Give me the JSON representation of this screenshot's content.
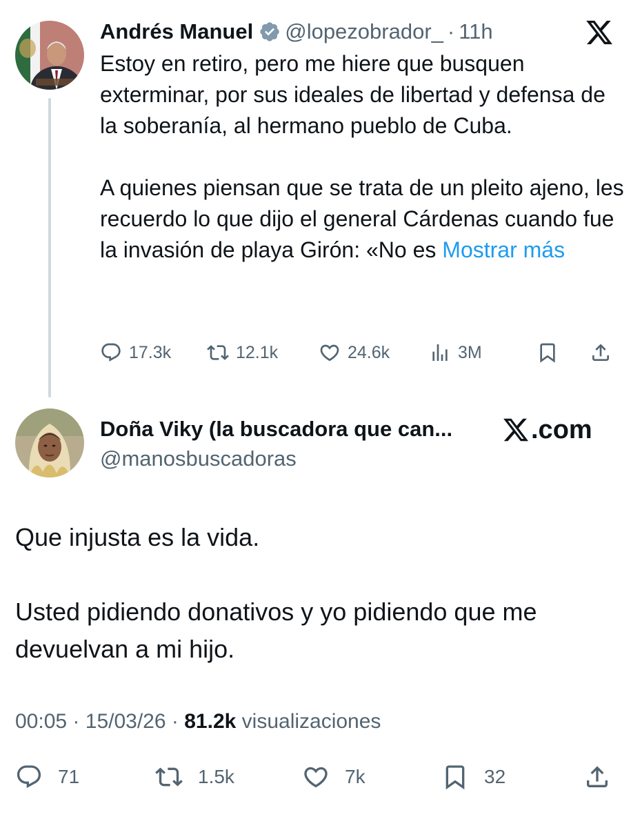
{
  "tweet_parent": {
    "display_name": "Andrés Manuel",
    "verified": true,
    "handle": "@lopezobrador_",
    "separator": "·",
    "time": "11h",
    "paragraph1": "Estoy en retiro, pero me hiere que busquen exterminar, por sus ideales de libertad y defensa de la soberanía, al hermano pueblo de Cuba.",
    "paragraph2": "A quienes piensan que se trata de un pleito ajeno, les recuerdo lo que dijo el general Cárdenas cuando fue la invasión de playa Girón: «No es",
    "show_more": "Mostrar más",
    "stats": {
      "replies": "17.3k",
      "reposts": "12.1k",
      "likes": "24.6k",
      "views": "3M"
    }
  },
  "tweet_reply": {
    "display_name": "Doña Viky (la buscadora que can...",
    "handle": "@manosbuscadoras",
    "brand_label": ".com",
    "paragraph1": "Que injusta es la vida.",
    "paragraph2": "Usted pidiendo donativos y yo pidiendo que me devuelvan a mi hijo.",
    "meta": {
      "time": "00:05",
      "dot1": "·",
      "date": "15/03/26",
      "dot2": "·",
      "views_count": "81.2k",
      "views_label": "visualizaciones"
    },
    "stats": {
      "replies": "71",
      "reposts": "1.5k",
      "likes": "7k",
      "bookmarks": "32"
    }
  },
  "colors": {
    "text_primary": "#0f1419",
    "text_secondary": "#536471",
    "link": "#1d9bf0",
    "verified_badge": "#829aab",
    "thread_line": "#cfd9de"
  },
  "icons": {
    "verified": "verified-badge-icon",
    "x_logo": "x-logo-icon",
    "reply": "reply-icon",
    "repost": "repost-icon",
    "like": "heart-icon",
    "views": "views-chart-icon",
    "bookmark": "bookmark-icon",
    "share": "share-icon"
  }
}
